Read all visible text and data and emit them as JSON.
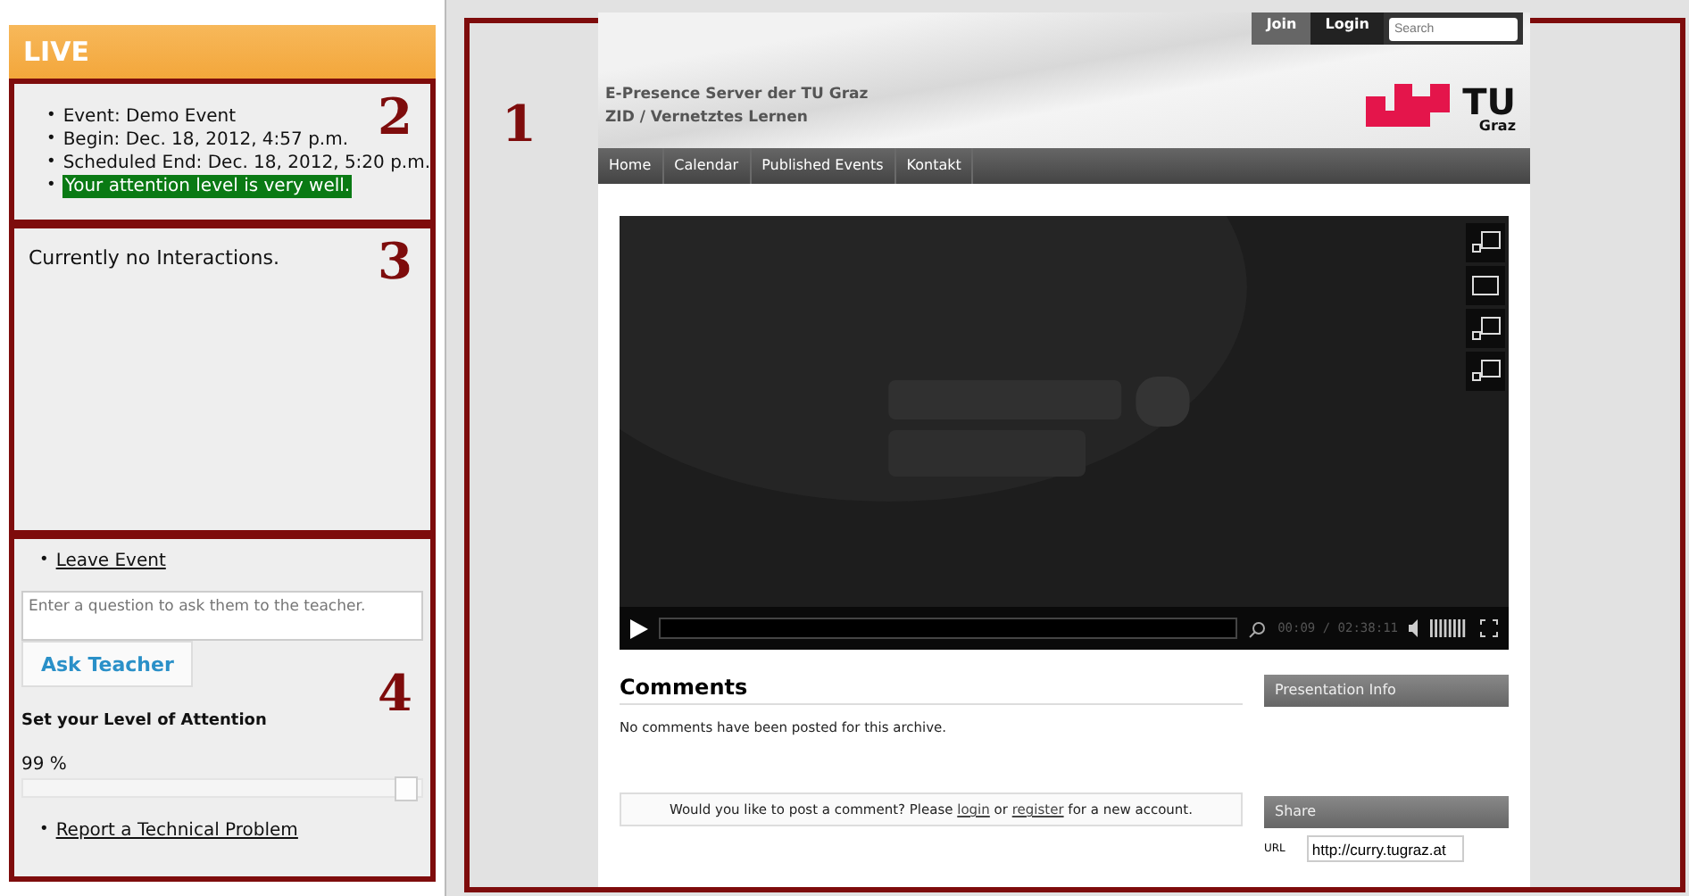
{
  "sidebar": {
    "title": "LIVE",
    "bullet": "•",
    "event_info": {
      "marker": "2",
      "items": [
        "Event: Demo Event",
        "Begin: Dec. 18, 2012, 4:57 p.m.",
        "Scheduled End: Dec. 18, 2012, 5:20 p.m."
      ],
      "attention_status": "Your attention level is very well."
    },
    "interactions": {
      "marker": "3",
      "text": "Currently no Interactions."
    },
    "controls": {
      "marker": "4",
      "leave_link": "Leave Event",
      "question": {
        "placeholder": "Enter a question to ask them to the teacher."
      },
      "ask_button": "Ask Teacher",
      "attention_label": "Set your Level of Attention",
      "attention_reading": "99 %",
      "attention": {
        "level": 0.99
      },
      "report_link": "Report a Technical Problem"
    }
  },
  "main": {
    "marker": "1",
    "top_bar": {
      "join": "Join",
      "login": "Login",
      "search": {
        "placeholder": "Search"
      }
    },
    "site_title": [
      "E-Presence Server der TU Graz",
      "ZID / Vernetztes Lernen"
    ],
    "logo": {
      "big": "TU",
      "small": "Graz"
    },
    "nav": [
      "Home",
      "Calendar",
      "Published Events",
      "Kontakt"
    ],
    "player": {
      "time": "00:09 / 02:38:11"
    },
    "comments": {
      "title": "Comments",
      "empty": "No comments have been posted for this archive.",
      "prompt": "Would you like to post a comment? Please ",
      "login": "login",
      "or": " or ",
      "register": "register",
      "suffix": " for a new account."
    },
    "presentation_info": "Presentation Info",
    "share": {
      "title": "Share",
      "url_label": "URL",
      "url_value": "http://curry.tugraz.at"
    }
  }
}
